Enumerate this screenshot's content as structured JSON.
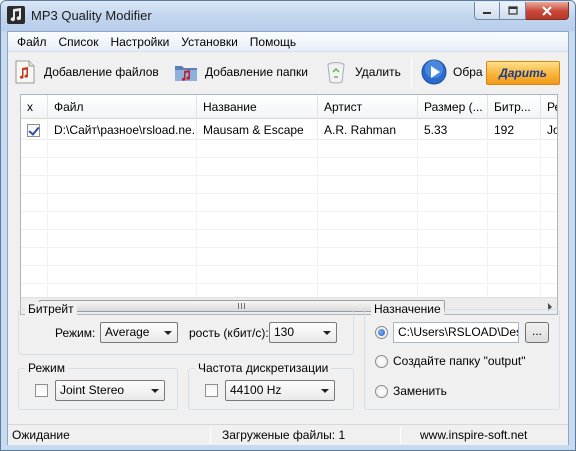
{
  "window": {
    "title": "MP3 Quality Modifier",
    "accent": "#1d5ebf"
  },
  "menu": {
    "items": [
      "Файл",
      "Список",
      "Настройки",
      "Установки",
      "Помощь"
    ]
  },
  "toolbar": {
    "add_files": "Добавление файлов",
    "add_folder": "Добавление папки",
    "delete": "Удалить",
    "process": "Обра",
    "donate": "Дарить",
    "icons": [
      "music-file-icon",
      "music-folder-icon",
      "recycle-bin-icon",
      "play-icon"
    ]
  },
  "grid": {
    "columns": [
      "x",
      "Файл",
      "Название",
      "Артист",
      "Размер  (...",
      "Битр...",
      "Ре"
    ],
    "rows": [
      {
        "checked": true,
        "file": "D:\\Сайт\\разное\\rsload.ne...",
        "title": "Mausam & Escape",
        "artist": "A.R. Rahman",
        "size": "5.33",
        "bitrate": "192",
        "extra": "Join"
      }
    ]
  },
  "bitrate_group": {
    "title": "Битрейт",
    "mode_label": "Режим:",
    "mode_value": "Average",
    "rate_label": "рость (кбит/с):",
    "rate_value": "130"
  },
  "mode_group": {
    "title": "Режим",
    "value": "Joint Stereo"
  },
  "samplerate_group": {
    "title": "Частота дискретизации",
    "value": "44100 Hz"
  },
  "destination_group": {
    "title": "Назначение",
    "path": "C:\\Users\\RSLOAD\\Desk",
    "browse_label": "...",
    "create_folder": "Создайте папку \"output\"",
    "replace": "Заменить"
  },
  "statusbar": {
    "status": "Ожидание",
    "loaded": "Загруженые файлы: 1",
    "site": "www.inspire-soft.net"
  }
}
